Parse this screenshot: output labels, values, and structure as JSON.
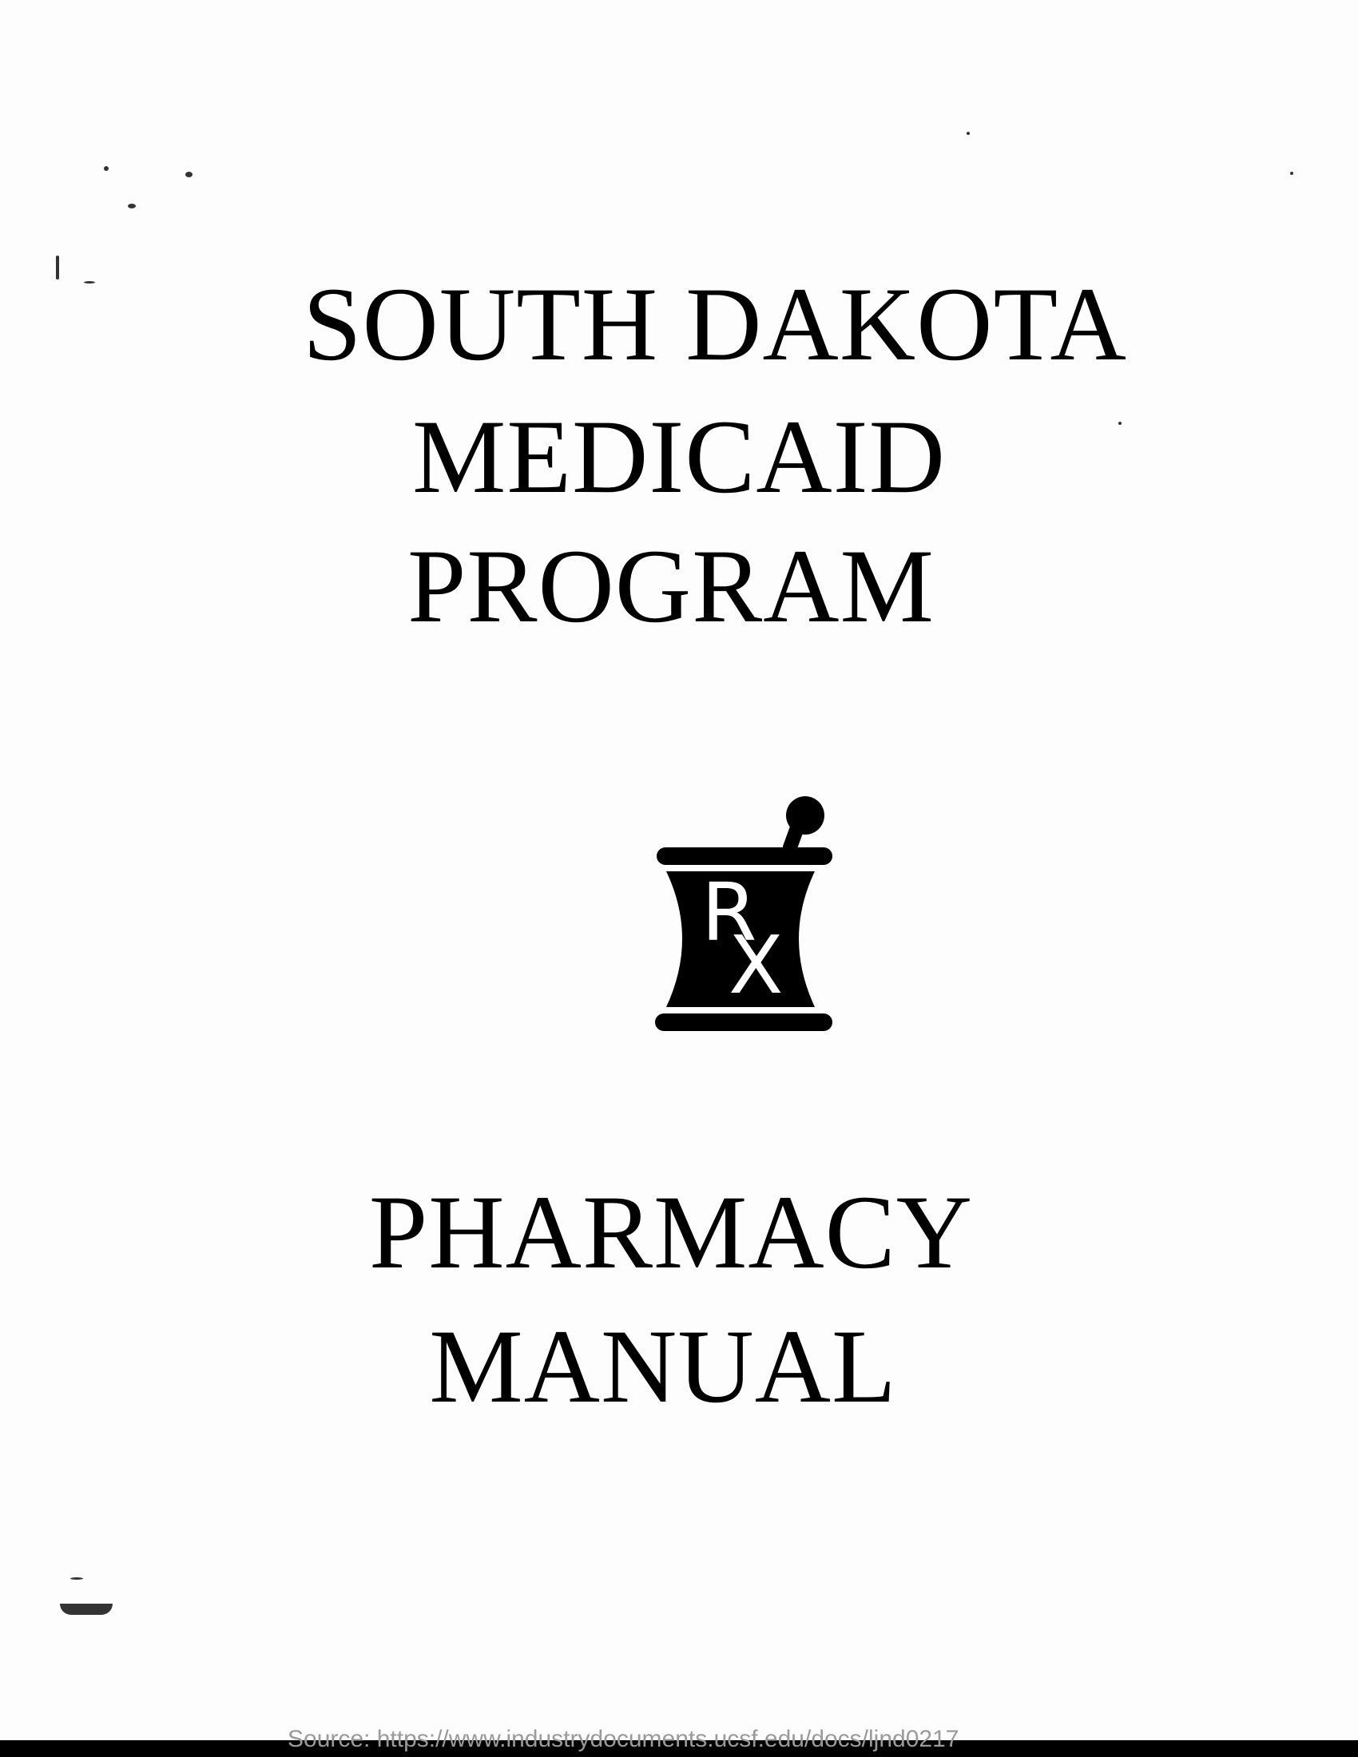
{
  "document": {
    "title_lines": [
      "SOUTH DAKOTA",
      "MEDICAID",
      "PROGRAM"
    ],
    "subtitle_lines": [
      "PHARMACY",
      "MANUAL"
    ],
    "logo": {
      "icon": "mortar-and-pestle-rx-icon",
      "letter_r": "R",
      "letter_x": "X"
    }
  },
  "footer": {
    "source": "Source: https://www.industrydocuments.ucsf.edu/docs/ljnd0217"
  },
  "colors": {
    "ink": "#000000",
    "paper": "#fdfdfd",
    "footer_text": "#9a9a9a"
  }
}
